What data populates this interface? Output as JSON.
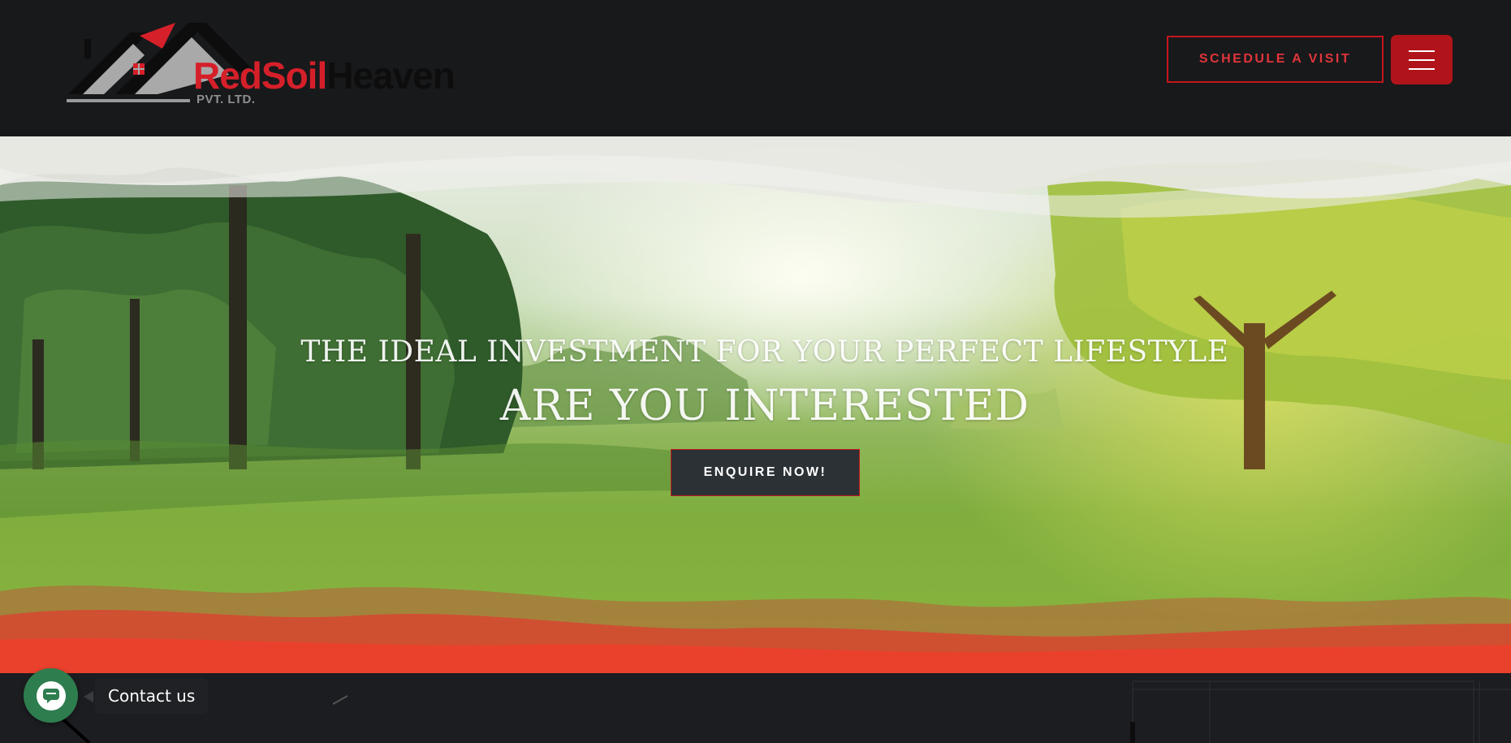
{
  "header": {
    "logo": {
      "word_red": "RedSoil",
      "word_black": "Heaven",
      "sub": "PVT. LTD.",
      "icon": "house-roofs-logo-icon"
    },
    "schedule_label": "SCHEDULE A VISIT",
    "menu_icon": "hamburger-menu-icon"
  },
  "hero": {
    "subtitle": "THE IDEAL INVESTMENT FOR YOUR PERFECT LIFESTYLE",
    "title": "ARE YOU INTERESTED",
    "cta_label": "ENQUIRE NOW!"
  },
  "contact": {
    "label": "Contact us",
    "icon": "chat-bubble-icon"
  },
  "colors": {
    "brand_red": "#c4161c",
    "header_bg": "#18191b",
    "button_dark": "#2c3136",
    "contact_green": "#2e7d4f"
  }
}
